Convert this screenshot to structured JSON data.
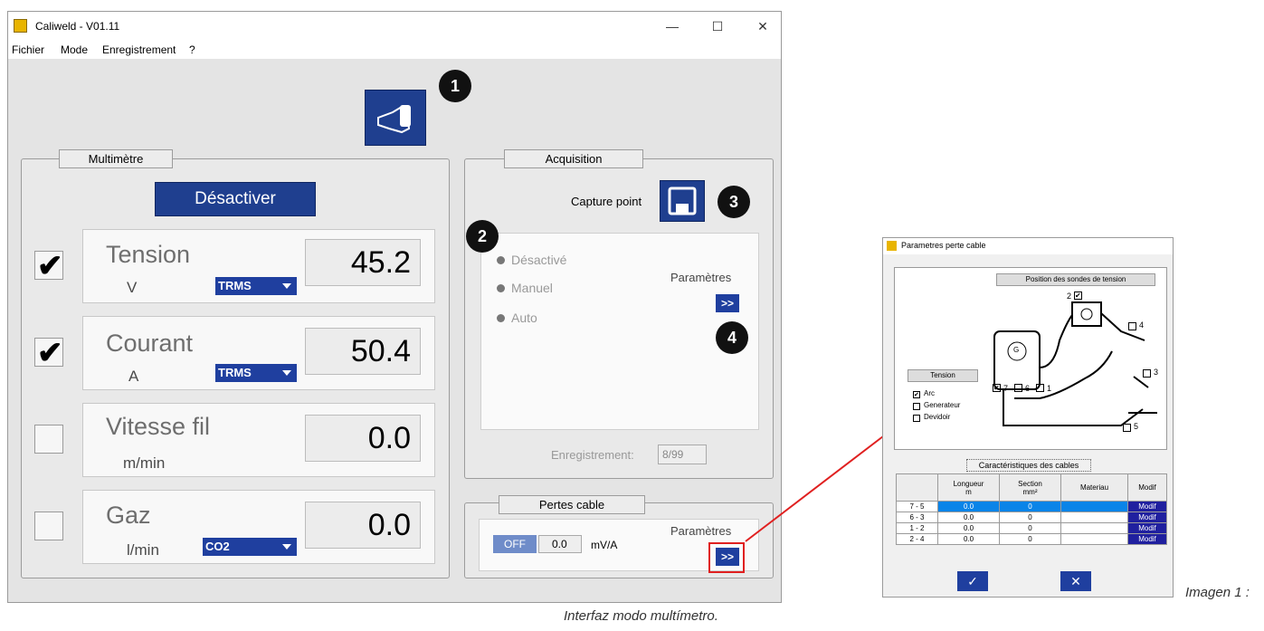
{
  "window": {
    "title": "Caliweld - V01.11",
    "controls": [
      "—",
      "☐",
      "✕"
    ]
  },
  "menu": [
    "Fichier",
    "Mode",
    "Enregistrement",
    "?"
  ],
  "callouts": [
    "1",
    "2",
    "3",
    "4"
  ],
  "multimetre": {
    "label": "Multimètre",
    "desactiver": "Désactiver",
    "rows": [
      {
        "name": "Tension",
        "unit": "V",
        "value": "45.2",
        "mode": "TRMS",
        "checked": true
      },
      {
        "name": "Courant",
        "unit": "A",
        "value": "50.4",
        "mode": "TRMS",
        "checked": true
      },
      {
        "name": "Vitesse fil",
        "unit": "m/min",
        "value": "0.0",
        "mode": "",
        "checked": false
      },
      {
        "name": "Gaz",
        "unit": "l/min",
        "value": "0.0",
        "mode": "CO2",
        "checked": false
      }
    ]
  },
  "acquisition": {
    "label": "Acquisition",
    "capture": "Capture point",
    "modes": [
      "Désactivé",
      "Manuel",
      "Auto"
    ],
    "parametres": "Paramètres",
    "more": ">>",
    "enregistrement_label": "Enregistrement:",
    "enregistrement_value": "8/99"
  },
  "pertes": {
    "label": "Pertes cable",
    "off": "OFF",
    "value": "0.0",
    "unit": "mV/A",
    "parametres": "Paramètres",
    "more": ">>"
  },
  "dialog": {
    "title": "Parametres perte cable",
    "position_label": "Position des sondes de tension",
    "tension_label": "Tension",
    "options": [
      {
        "label": "Arc",
        "checked": true
      },
      {
        "label": "Generateur",
        "checked": false
      },
      {
        "label": "Devidoir",
        "checked": false
      }
    ],
    "diagram_numbers": [
      "2",
      "4",
      "3",
      "7",
      "6",
      "1",
      "5"
    ],
    "generator_symbol": "G",
    "cables_label": "Caractéristiques des cables",
    "headers": [
      "",
      "Longueur\nm",
      "Section\nmm²",
      "Materiau",
      "Modif"
    ],
    "rows": [
      {
        "id": "7 - 5",
        "longueur": "0.0",
        "section": "0",
        "materiau": "",
        "modif": "Modif"
      },
      {
        "id": "6 - 3",
        "longueur": "0.0",
        "section": "0",
        "materiau": "",
        "modif": "Modif"
      },
      {
        "id": "1 - 2",
        "longueur": "0.0",
        "section": "0",
        "materiau": "",
        "modif": "Modif"
      },
      {
        "id": "2 - 4",
        "longueur": "0.0",
        "section": "0",
        "materiau": "",
        "modif": "Modif"
      }
    ],
    "ok": "✓",
    "cancel": "✕"
  },
  "caption": {
    "line1": "Imagen 1 :",
    "line2": "Interfaz modo multímetro."
  },
  "colors": {
    "accent": "#1f3f8f",
    "highlight": "#e02020",
    "row_selected": "#0a84e8"
  }
}
